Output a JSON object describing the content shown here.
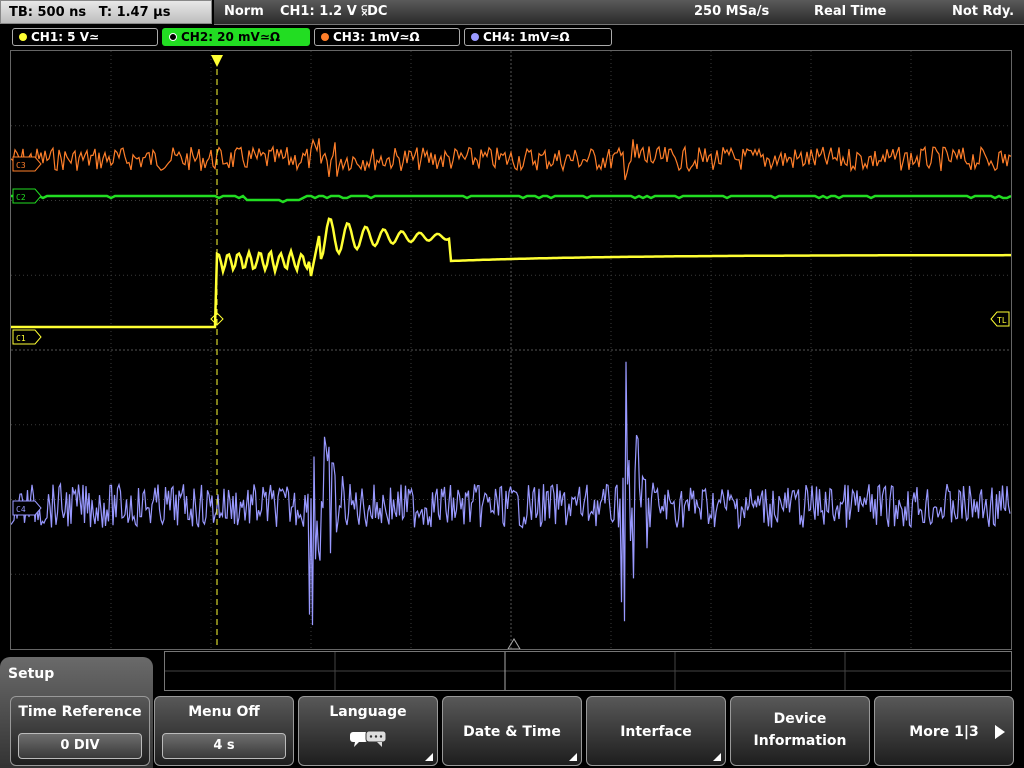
{
  "header": {
    "timebase": "TB: 500 ns",
    "trigger_time": "T: 1.47 µs",
    "mode": "Norm",
    "trigger_info": "CH1: 1.2 V",
    "trigger_slope": "⫁DC",
    "sample_rate": "250 MSa/s",
    "acq_mode": "Real Time",
    "status": "Not Rdy."
  },
  "channels": [
    {
      "label": "CH1: 5 V≃",
      "color": "#ffff33",
      "active": false
    },
    {
      "label": "CH2: 20 mV≃Ω",
      "color": "#22dd22",
      "active": true
    },
    {
      "label": "CH3: 1mV≃Ω",
      "color": "#ff7f2a",
      "active": false
    },
    {
      "label": "CH4: 1mV≃Ω",
      "color": "#9999ff",
      "active": false
    }
  ],
  "markers": {
    "c1": "C1",
    "c2": "C2",
    "c3": "C3",
    "c4": "C4",
    "trigger_level": "TL"
  },
  "menu": {
    "title": "Setup",
    "time_reference": {
      "label": "Time Reference",
      "value": "0 DIV"
    },
    "menu_off": {
      "label": "Menu Off",
      "value": "4 s"
    },
    "language": {
      "label": "Language"
    },
    "date_time": {
      "label": "Date & Time"
    },
    "interface": {
      "label": "Interface"
    },
    "device_info": {
      "line1": "Device",
      "line2": "Information"
    },
    "more": {
      "label": "More 1|3"
    }
  },
  "colors": {
    "ch1": "#ffff33",
    "ch2": "#22dd22",
    "ch3": "#ff7f2a",
    "ch4": "#9999ff",
    "grid": "#555555"
  }
}
